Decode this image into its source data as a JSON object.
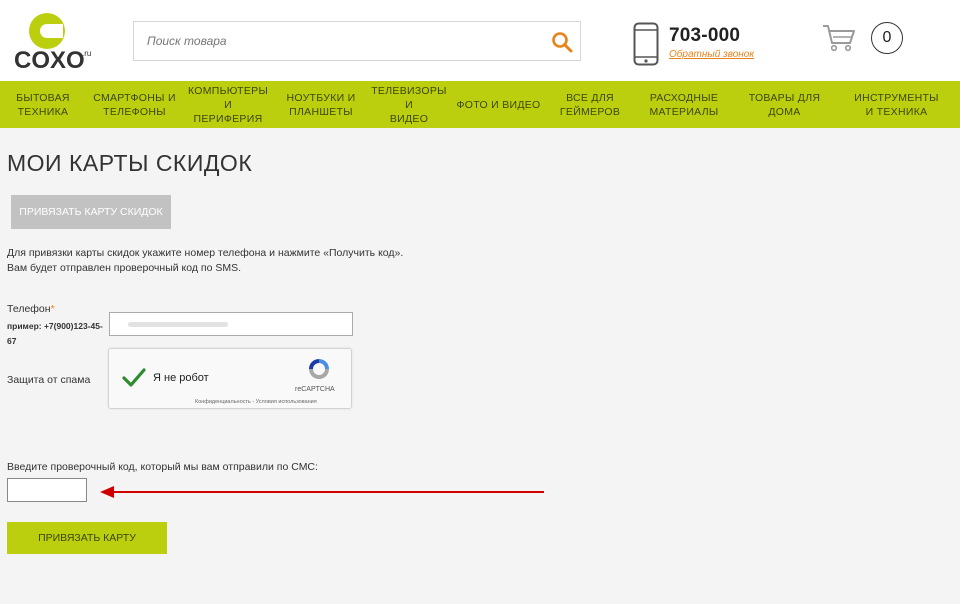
{
  "header": {
    "logo_text": "COXO",
    "logo_suffix": ".ru",
    "search_placeholder": "Поиск товара",
    "phone": "703-000",
    "callback_link": "Обратный звонок",
    "cart_count": "0"
  },
  "nav": {
    "items": [
      {
        "line1": "Бытовая",
        "line2": "техника",
        "width": 86
      },
      {
        "line1": "Смартфоны и",
        "line2": "телефоны",
        "width": 97
      },
      {
        "line1": "Компьютеры и",
        "line2": "периферия",
        "width": 90
      },
      {
        "line1": "Ноутбуки и",
        "line2": "планшеты",
        "width": 96
      },
      {
        "line1": "Телевизоры и",
        "line2": "видео",
        "width": 80
      },
      {
        "line1": "Фото и видео",
        "line2": "",
        "width": 99
      },
      {
        "line1": "Все для",
        "line2": "геймеров",
        "width": 84
      },
      {
        "line1": "Расходные",
        "line2": "материалы",
        "width": 104
      },
      {
        "line1": "Товары для",
        "line2": "дома",
        "width": 97
      },
      {
        "line1": "Инструменты",
        "line2": "и техника",
        "width": 127
      }
    ]
  },
  "main": {
    "title": "Мои карты скидок",
    "link_card_button": "Привязать карту скидок",
    "info_line1": "Для привязки карты скидок укажите номер телефона и нажмите «Получить код».",
    "info_line2": "Вам будет отправлен проверочный код по SMS.",
    "phone_label": "Телефон",
    "required_mark": "*",
    "phone_example": "пример: +7(900)123-45-67",
    "spam_label": "Защита от спама",
    "captcha_label": "Я не робот",
    "captcha_brand": "reCAPTCHA",
    "captcha_links": "Конфиденциальность - Условия использования",
    "code_label": "Введите проверочный код, который мы вам отправили по СМС:",
    "submit_button": "Привязать карту"
  },
  "colors": {
    "accent_green": "#bccf0f",
    "orange": "#e8821a",
    "arrow_red": "#d00000",
    "button_gray": "#c2c2c2"
  }
}
